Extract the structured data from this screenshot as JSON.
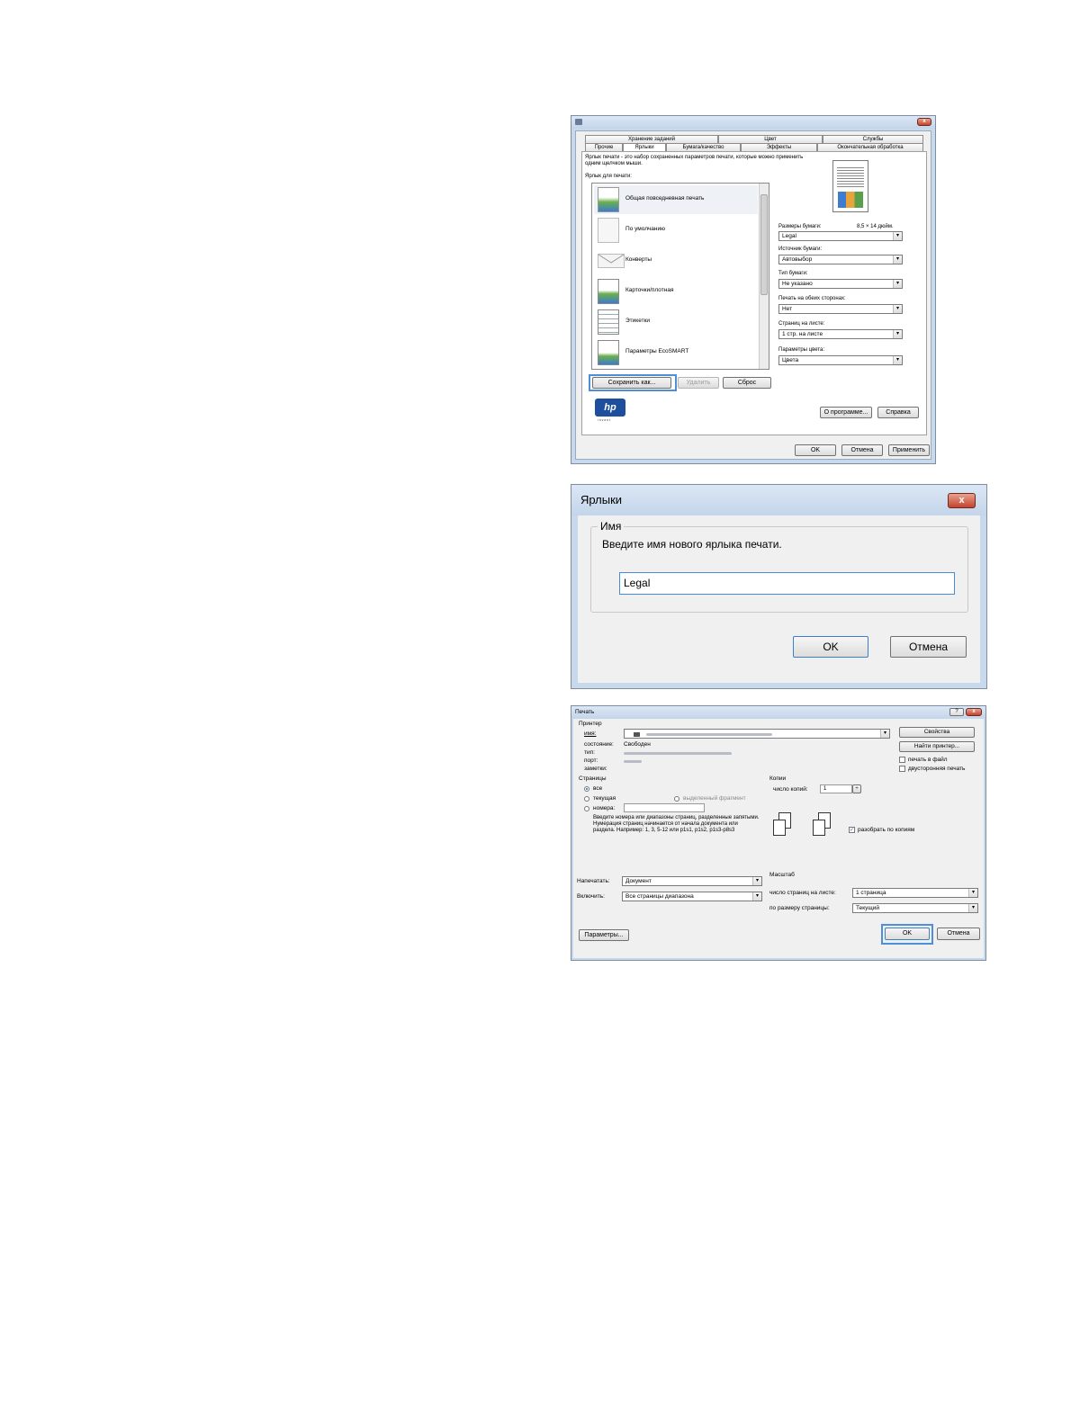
{
  "properties_dialog": {
    "tabs_row1": [
      "Хранение заданий",
      "Цвет",
      "Службы"
    ],
    "tabs_row2": [
      "Прочие",
      "Ярлыки",
      "Бумага/качество",
      "Эффекты",
      "Окончательная обработка"
    ],
    "active_tab": "Ярлыки",
    "description": "Ярлык печати - это набор сохраненных параметров печати, которые можно применить одним щелчком мыши.",
    "shortcuts_label": "Ярлык для печати:",
    "shortcuts": [
      {
        "label": "Общая повседневная печать",
        "icon": "document-icon",
        "selected": true
      },
      {
        "label": "По умолчанию",
        "icon": "blank-page-icon"
      },
      {
        "label": "Конверты",
        "icon": "envelope-icon"
      },
      {
        "label": "Карточки/плотная",
        "icon": "card-icon"
      },
      {
        "label": "Этикетки",
        "icon": "labels-icon"
      },
      {
        "label": "Параметры EcoSMART",
        "icon": "ecosmart-icon"
      }
    ],
    "paper_size_label": "Размеры бумаги:",
    "paper_size_value": "8,5 × 14 дюйм.",
    "fields": [
      {
        "label": "",
        "value": "Legal"
      },
      {
        "label": "Источник бумаги:",
        "value": "Автовыбор"
      },
      {
        "label": "Тип бумаги:",
        "value": "Не указано"
      },
      {
        "label": "Печать на обеих сторонах:",
        "value": "Нет"
      },
      {
        "label": "Страниц на листе:",
        "value": "1 стр. на листе"
      },
      {
        "label": "Параметры цвета:",
        "value": "Цвета"
      }
    ],
    "buttons": {
      "save_as": "Сохранить как...",
      "delete": "Удалить",
      "reset": "Сброс",
      "about": "О программе...",
      "help": "Справка",
      "ok": "OK",
      "cancel": "Отмена",
      "apply": "Применить"
    },
    "logo_text": "hp",
    "logo_tagline": "i n v e n t",
    "close_glyph": "x"
  },
  "shortcut_dialog": {
    "title": "Ярлыки",
    "group_label": "Имя",
    "prompt": "Введите имя нового ярлыка печати.",
    "input_value": "Legal",
    "ok": "OK",
    "cancel": "Отмена",
    "close_glyph": "x"
  },
  "print_dialog": {
    "title": "Печать",
    "printer_group": "Принтер",
    "name_label": "имя:",
    "status_label": "состояние:",
    "status_value": "Свободен",
    "type_label": "тип:",
    "port_label": "порт:",
    "notes_label": "заметки:",
    "properties_button": "Свойства",
    "find_printer_button": "Найти принтер...",
    "print_to_file": "печать в файл",
    "duplex": "двусторонняя печать",
    "pages_group": "Страницы",
    "all": "все",
    "current": "текущая",
    "selection": "выделенный фрагмент",
    "numbers": "номера:",
    "pages_hint": "Введите номера или диапазоны страниц, разделенные запятыми. Нумерация страниц начинается от начала документа или раздела. Например: 1, 3, 5-12 или p1s1, p1s2, p1s3-p8s3",
    "copies_group": "Копии",
    "copies_label": "число копий:",
    "copies_value": "1",
    "collate": "разобрать по копиям",
    "print_what_label": "Напечатать:",
    "print_what_value": "Документ",
    "include_label": "Включить:",
    "include_value": "Все страницы диапазона",
    "scale_group": "Масштаб",
    "pages_per_sheet_label": "число страниц на листе:",
    "pages_per_sheet_value": "1 страница",
    "scale_to_label": "по размеру страницы:",
    "scale_to_value": "Текущий",
    "options_button": "Параметры...",
    "ok": "OK",
    "cancel": "Отмена",
    "help_glyph": "?",
    "close_glyph": "x"
  }
}
